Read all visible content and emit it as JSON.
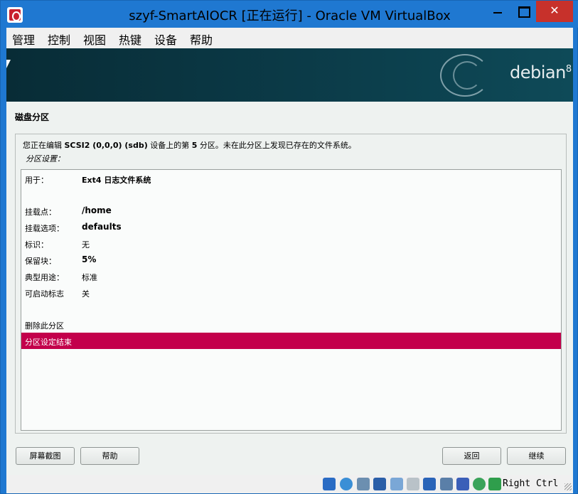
{
  "window": {
    "title": "szyf-SmartAIOCR [正在运行] - Oracle VM VirtualBox",
    "close_label": "✕"
  },
  "menu": [
    "管理",
    "控制",
    "视图",
    "热键",
    "设备",
    "帮助"
  ],
  "installer": {
    "brand": "debian",
    "brand_version": "8",
    "page_title": "磁盘分区",
    "description_prefix": "您正在编辑 ",
    "description_device": "SCSI2 (0,0,0) (sdb)",
    "description_mid": " 设备上的第 ",
    "description_partition": "5",
    "description_suffix": " 分区。未在此分区上发现已存在的文件系统。",
    "subheading": "分区设置：",
    "rows": [
      {
        "label": "用于：",
        "value": "Ext4 日志文件系统",
        "bold": true
      },
      {
        "label": "挂载点：",
        "value": "/home",
        "bold": true
      },
      {
        "label": "挂载选项：",
        "value": "defaults",
        "bold": true
      },
      {
        "label": "标识：",
        "value": "无",
        "bold": false
      },
      {
        "label": "保留块：",
        "value": "5%",
        "bold": true
      },
      {
        "label": "典型用途：",
        "value": "标准",
        "bold": false
      },
      {
        "label": "可启动标志",
        "value": "关",
        "bold": false
      }
    ],
    "delete_label": "删除此分区",
    "done_label": "分区设定结束",
    "buttons": {
      "screenshot": "屏幕截图",
      "help": "帮助",
      "back": "返回",
      "continue": "继续"
    }
  },
  "statusbar": {
    "host_key": "Right Ctrl",
    "icons": [
      "hdd-icon",
      "optical-icon",
      "audio-icon",
      "network-icon",
      "usb-icon",
      "shared-folder-icon",
      "display-icon",
      "video-capture-icon",
      "virtualization-icon",
      "mouse-integration-icon",
      "download-icon"
    ]
  },
  "colors": {
    "titlebar": "#1f78d1",
    "close_button": "#c7312b",
    "selection": "#c3004b"
  }
}
